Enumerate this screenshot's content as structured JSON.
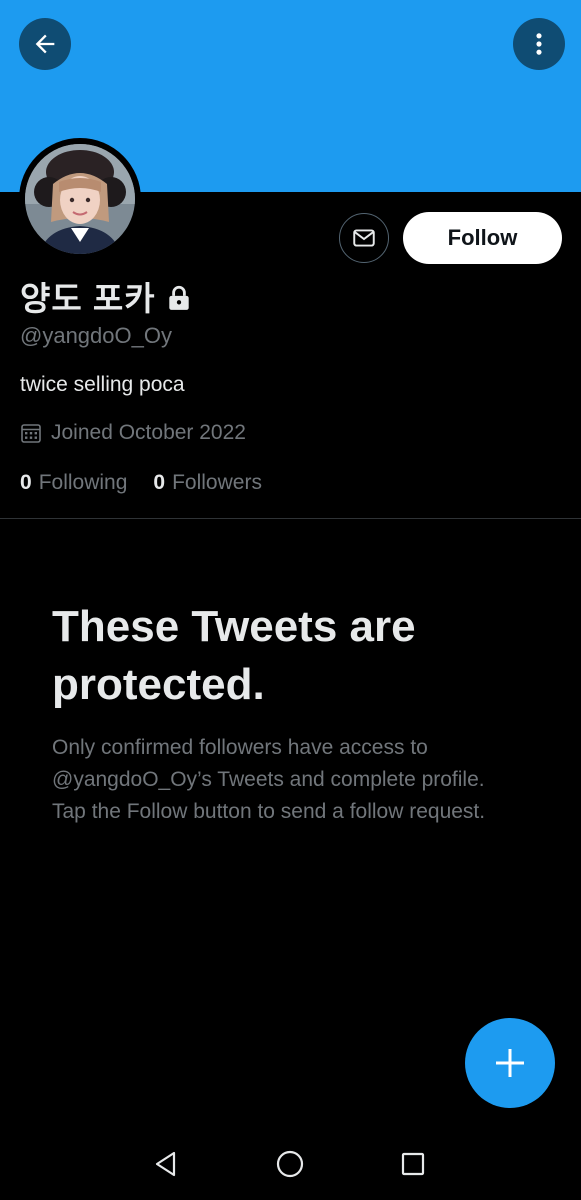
{
  "header": {
    "back_icon": "arrow-left-icon",
    "more_icon": "more-vertical-icon",
    "banner_color": "#1d9bf0"
  },
  "profile": {
    "display_name": "양도 포카",
    "protected_icon": "lock-icon",
    "handle": "@yangdoO_Oy",
    "bio": "twice selling poca",
    "joined": "Joined October 2022",
    "following_count": "0",
    "following_label": "Following",
    "followers_count": "0",
    "followers_label": "Followers"
  },
  "actions": {
    "message_icon": "envelope-icon",
    "follow_label": "Follow"
  },
  "protected_notice": {
    "title": "These Tweets are protected.",
    "body": "Only confirmed followers have access to @yangdoO_Oy’s Tweets and complete profile. Tap the Follow button to send a follow request."
  },
  "fab": {
    "icon": "plus-icon",
    "color": "#1d9bf0"
  },
  "system_nav": {
    "back_icon": "triangle-back-icon",
    "home_icon": "circle-home-icon",
    "recents_icon": "square-recents-icon"
  }
}
